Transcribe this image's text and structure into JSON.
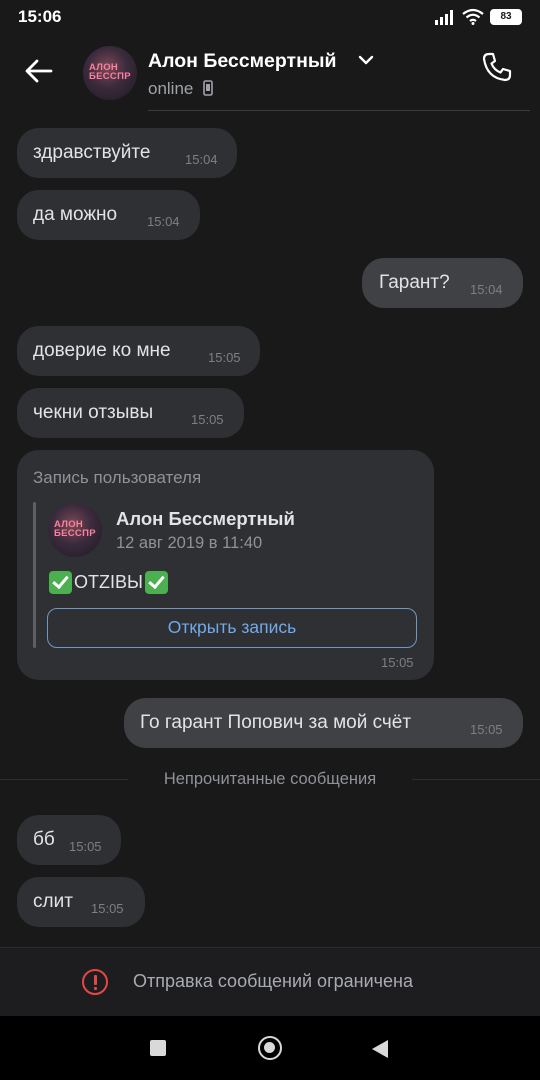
{
  "status_bar": {
    "time": "15:06",
    "battery": "83"
  },
  "header": {
    "contact_name": "Алон Бессмертный",
    "status": "online",
    "avatar_text_line1": "АЛОН",
    "avatar_text_line2": "БЕССПР"
  },
  "messages": [
    {
      "text": "здравствуйте",
      "time": "15:04"
    },
    {
      "text": "да можно",
      "time": "15:04"
    },
    {
      "text": "Гарант?",
      "time": "15:04"
    },
    {
      "text": "доверие ко мне",
      "time": "15:05"
    },
    {
      "text": "чекни отзывы",
      "time": "15:05"
    },
    {
      "text": "Го гарант Попович за мой счёт",
      "time": "15:05"
    },
    {
      "text": "бб",
      "time": "15:05"
    },
    {
      "text": "слит",
      "time": "15:05"
    }
  ],
  "shared_post": {
    "title": "Запись пользователя",
    "author": "Алон Бессмертный",
    "date": "12 авг 2019 в 11:40",
    "text": "OTZIBЫ",
    "button_label": "Открыть запись",
    "time": "15:05"
  },
  "unread_label": "Непрочитанные сообщения",
  "restriction_text": "Отправка сообщений ограничена",
  "colors": {
    "background": "#19191a",
    "bubble_in": "#2f3033",
    "bubble_out": "#404144",
    "link": "#71aaeb",
    "warning": "#e64646"
  },
  "icons": [
    "back-arrow-icon",
    "chevron-down-icon",
    "mobile-icon",
    "phone-icon",
    "signal-icon",
    "wifi-icon",
    "battery-icon",
    "warning-icon"
  ]
}
